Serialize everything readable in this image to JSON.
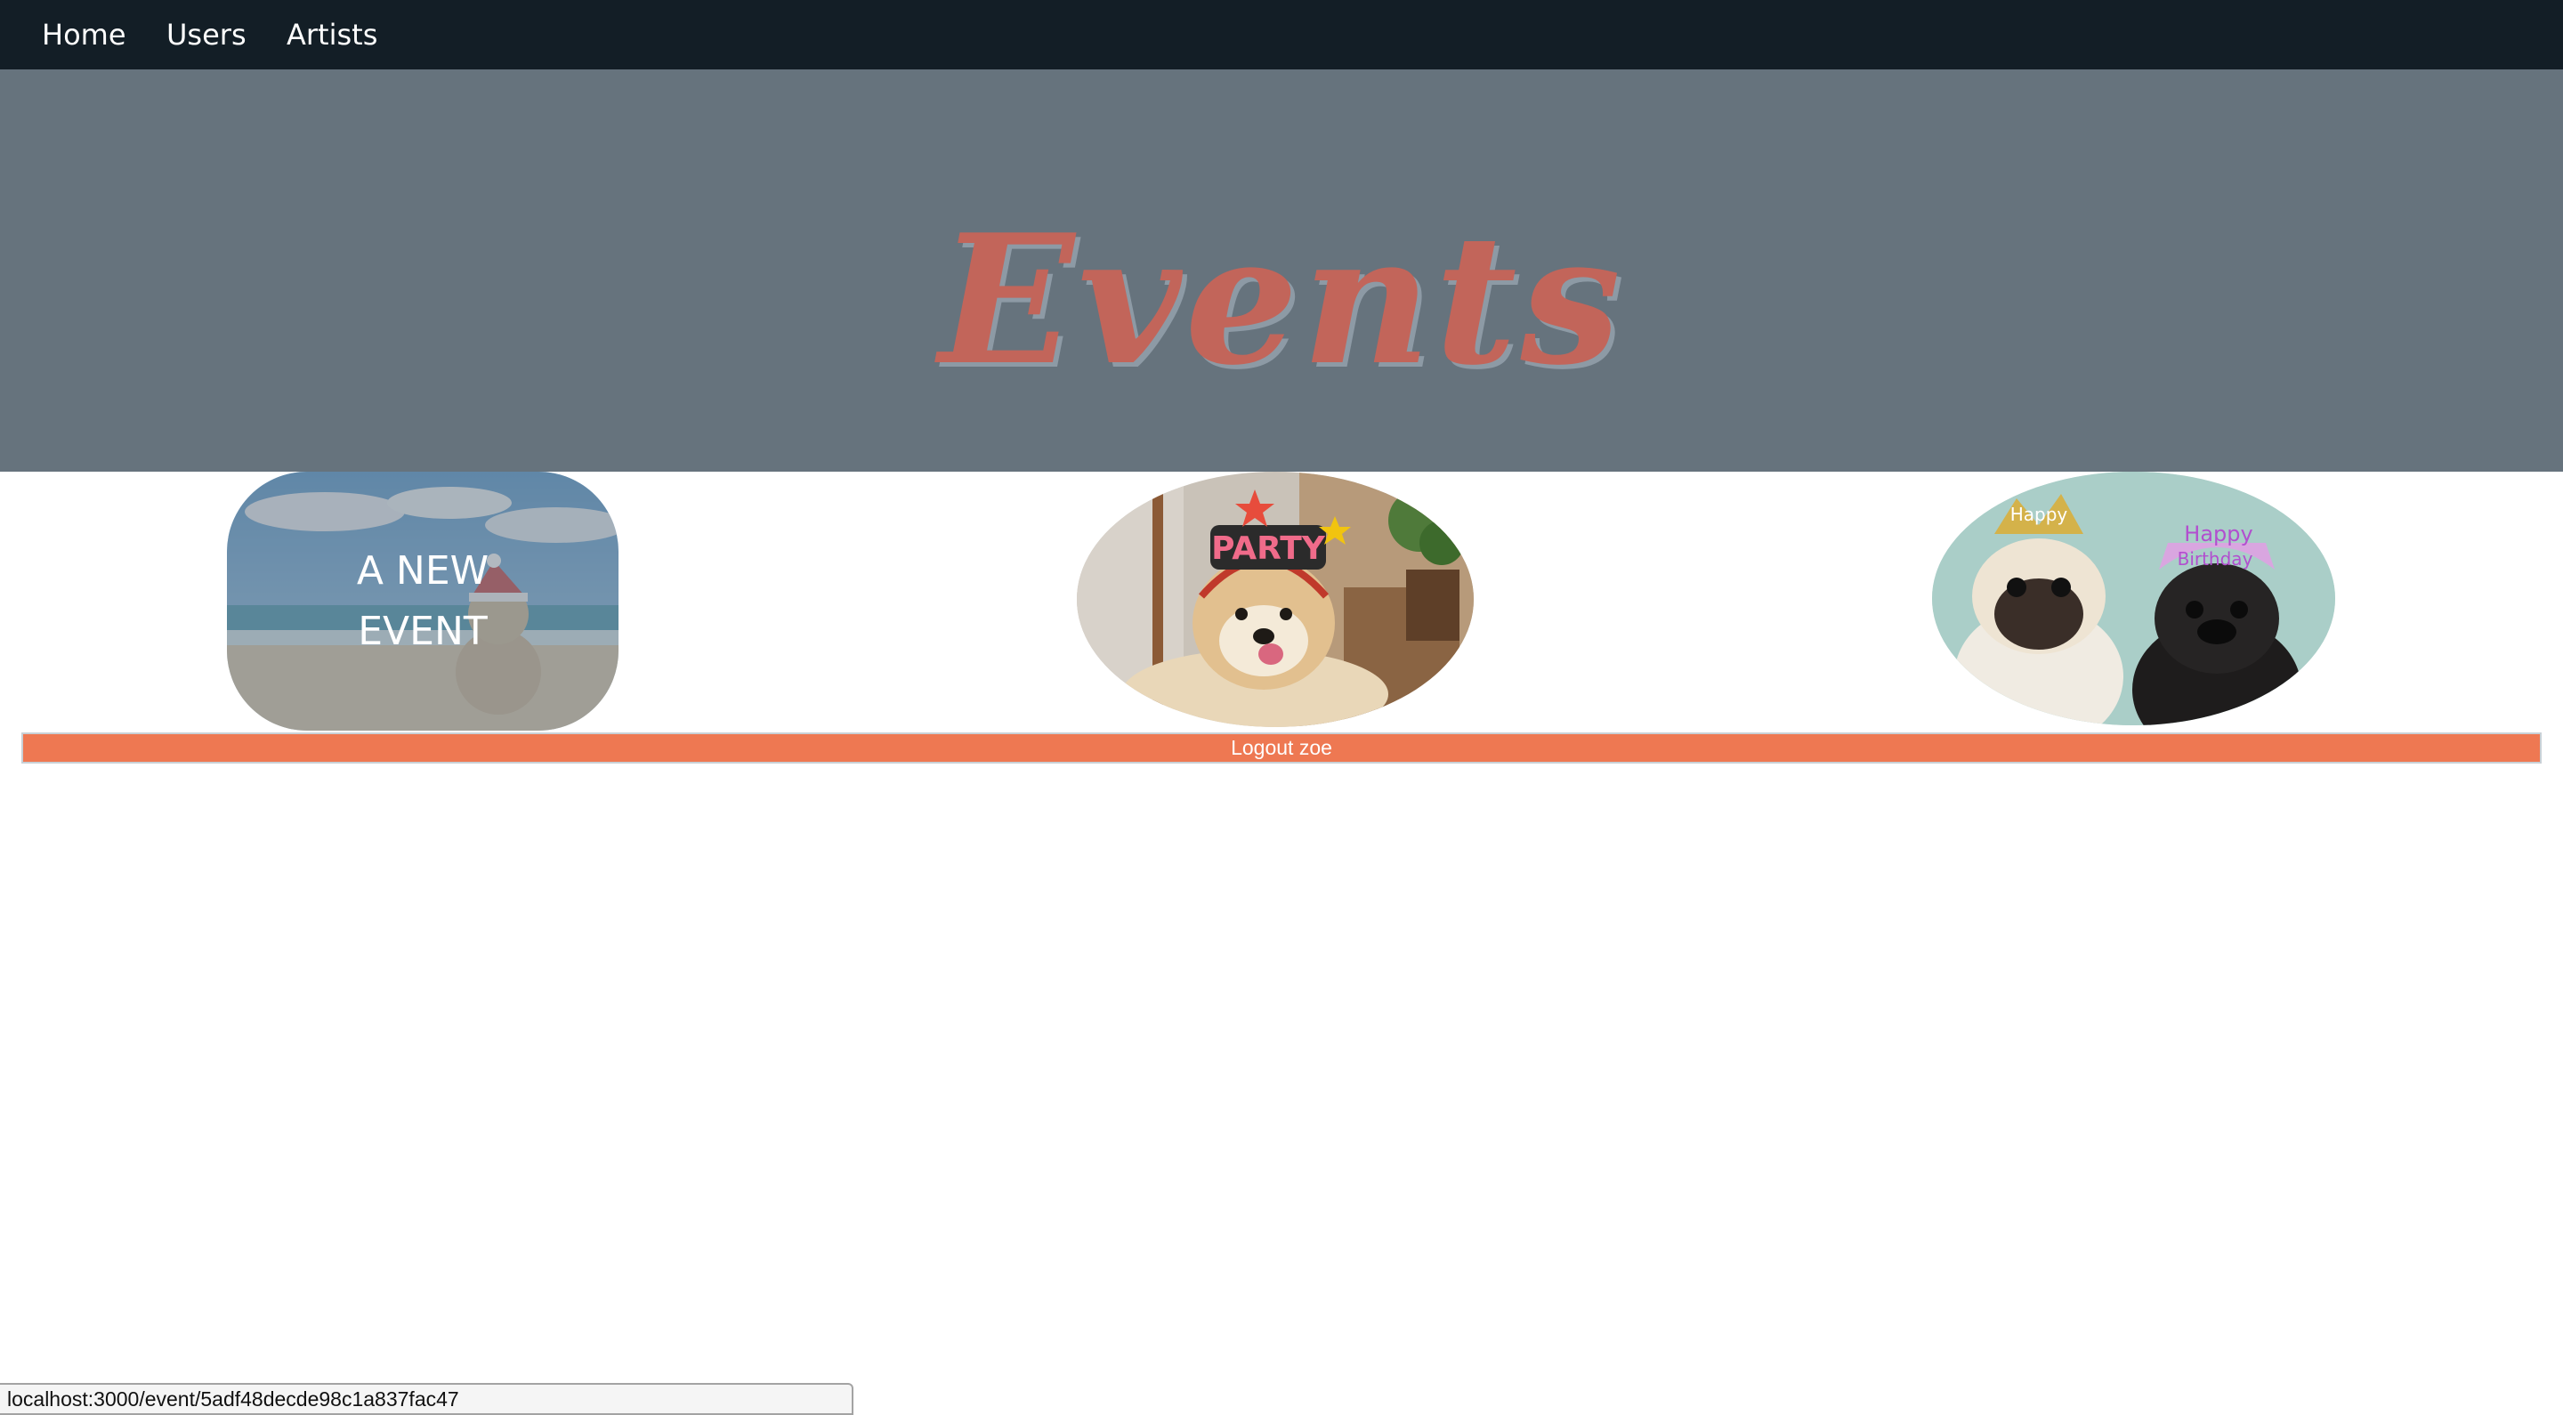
{
  "nav": {
    "items": [
      {
        "label": "Home"
      },
      {
        "label": "Users"
      },
      {
        "label": "Artists"
      }
    ]
  },
  "hero": {
    "title": "Events"
  },
  "events": [
    {
      "label": "A NEW EVENT",
      "image": "beach-snowman-photo"
    },
    {
      "label": "",
      "image": "dog-party-headband-photo"
    },
    {
      "label": "",
      "image": "pugs-birthday-hats-photo"
    }
  ],
  "logout": {
    "label": "Logout zoe"
  },
  "status_bar": {
    "url": "localhost:3000/event/5adf48decde98c1a837fac47"
  },
  "colors": {
    "navbar": "#131e26",
    "hero_bg": "#66737d",
    "title": "#c2655a",
    "logout": "#ee7852"
  }
}
